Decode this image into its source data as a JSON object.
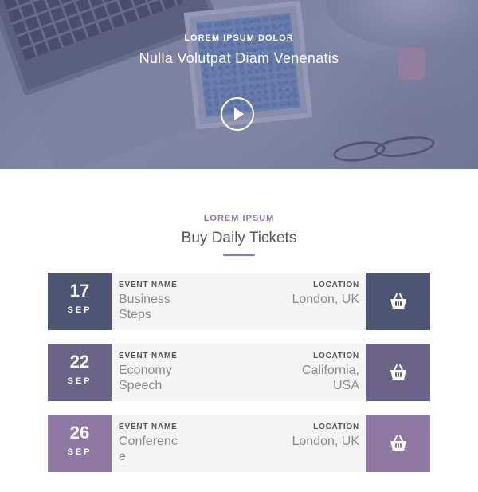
{
  "hero": {
    "eyebrow": "LOREM IPSUM DOLOR",
    "title": "Nulla Volutpat Diam Venenatis",
    "play_icon": "play-icon"
  },
  "section": {
    "eyebrow": "LOREM IPSUM",
    "title": "Buy Daily Tickets",
    "accent": "#8c78a6"
  },
  "labels": {
    "event_name": "EVENT NAME",
    "location": "LOCATION"
  },
  "tickets": [
    {
      "day": "17",
      "month": "SEP",
      "event": "Business Steps",
      "location": "London, UK",
      "color": "#4e5473",
      "buy_icon": "shopping-bag-icon"
    },
    {
      "day": "22",
      "month": "SEP",
      "event": "Economy Speech",
      "location": "California, USA",
      "color": "#6b6488",
      "buy_icon": "shopping-bag-icon"
    },
    {
      "day": "26",
      "month": "SEP",
      "event": "Conference",
      "location": "London, UK",
      "color": "#8e79a3",
      "buy_icon": "shopping-bag-icon"
    }
  ]
}
